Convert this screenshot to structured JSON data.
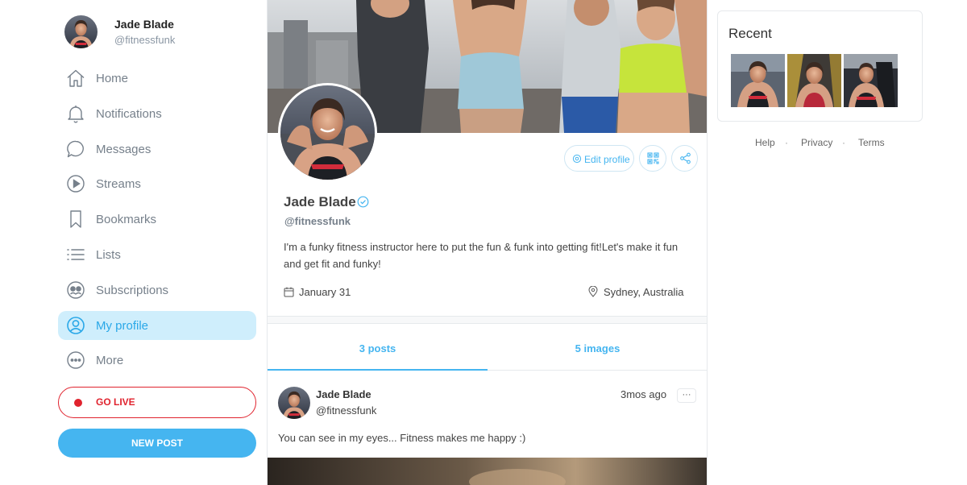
{
  "user": {
    "name": "Jade Blade",
    "handle": "@fitnessfunk"
  },
  "nav": {
    "items": [
      {
        "label": "Home",
        "icon": "home-icon",
        "active": false
      },
      {
        "label": "Notifications",
        "icon": "bell-icon",
        "active": false
      },
      {
        "label": "Messages",
        "icon": "chat-bubble-icon",
        "active": false
      },
      {
        "label": "Streams",
        "icon": "play-circle-icon",
        "active": false
      },
      {
        "label": "Bookmarks",
        "icon": "bookmark-icon",
        "active": false
      },
      {
        "label": "Lists",
        "icon": "list-icon",
        "active": false
      },
      {
        "label": "Subscriptions",
        "icon": "subscriptions-icon",
        "active": false
      },
      {
        "label": "My profile",
        "icon": "user-circle-icon",
        "active": true
      },
      {
        "label": "More",
        "icon": "more-circle-icon",
        "active": false
      }
    ],
    "go_live_label": "GO LIVE",
    "new_post_label": "NEW POST"
  },
  "profile": {
    "name": "Jade Blade",
    "handle": "@fitnessfunk",
    "bio": "I'm a funky fitness instructor here to put the fun & funk into getting fit!Let's make it fun and get fit and funky!",
    "date": "January 31",
    "location": "Sydney, Australia",
    "edit_label": "Edit profile",
    "verified": true
  },
  "tabs": [
    {
      "label": "3 posts",
      "active": true
    },
    {
      "label": "5 images",
      "active": false
    }
  ],
  "post": {
    "author": "Jade Blade",
    "handle": "@fitnessfunk",
    "time": "3mos ago",
    "more_label": "···",
    "text": "You can see in my eyes... Fitness makes me happy :)"
  },
  "recent": {
    "title": "Recent",
    "thumbnail_count": 3
  },
  "footer": {
    "links": [
      "Help",
      "Privacy",
      "Terms"
    ],
    "separator": "·"
  },
  "colors": {
    "accent": "#45b5f0",
    "active_bg": "#cfeefc",
    "live_red": "#e0232e",
    "muted_text": "#76808b",
    "border": "#e6e9ec"
  }
}
